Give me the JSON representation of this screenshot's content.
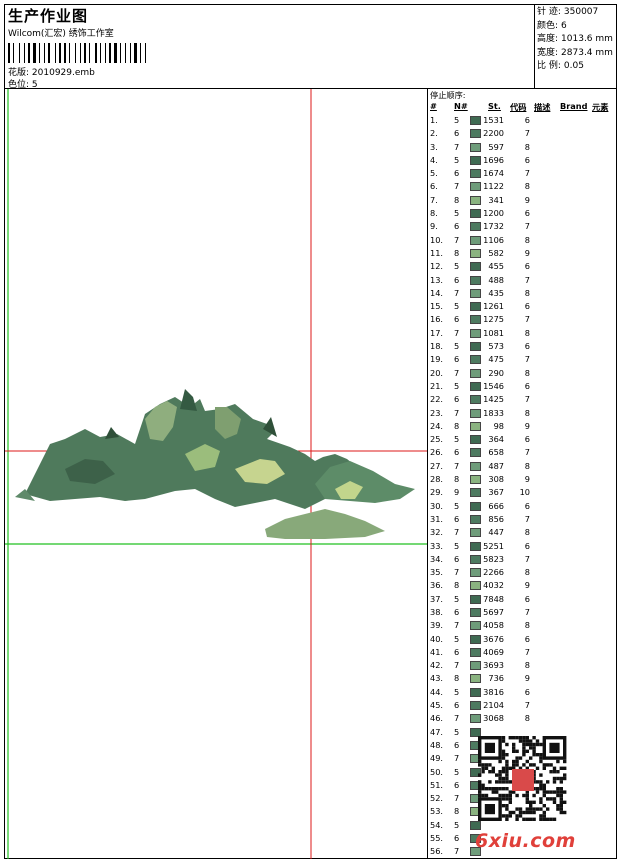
{
  "header": {
    "title": "生产作业图",
    "company": "Wilcom(汇宏) 绣饰工作室",
    "design_label": "花版:",
    "design_value": "2010929.emb",
    "color_label": "色位:",
    "color_value": "5"
  },
  "stats": [
    {
      "label": "针 迹:",
      "value": "350007"
    },
    {
      "label": "颜色:",
      "value": "6"
    },
    {
      "label": "高度:",
      "value": "1013.6 mm"
    },
    {
      "label": "宽度:",
      "value": "2873.4 mm"
    },
    {
      "label": "比 例:",
      "value": "0.05"
    }
  ],
  "legend": {
    "title": "停止顺序:",
    "headers": {
      "num": "#",
      "n": "N#",
      "st": "St.",
      "code": "代码",
      "desc": "描述",
      "brand": "Brand",
      "elem": "元素"
    },
    "colors": {
      "5": "#3f6a52",
      "6": "#4d7a60",
      "7": "#6e9c7a",
      "8": "#8ab380"
    },
    "rows": [
      {
        "num": "1.",
        "n": "5",
        "st": "1531",
        "code": "6"
      },
      {
        "num": "2.",
        "n": "6",
        "st": "2200",
        "code": "7"
      },
      {
        "num": "3.",
        "n": "7",
        "st": "597",
        "code": "8"
      },
      {
        "num": "4.",
        "n": "5",
        "st": "1696",
        "code": "6"
      },
      {
        "num": "5.",
        "n": "6",
        "st": "1674",
        "code": "7"
      },
      {
        "num": "6.",
        "n": "7",
        "st": "1122",
        "code": "8"
      },
      {
        "num": "7.",
        "n": "8",
        "st": "341",
        "code": "9"
      },
      {
        "num": "8.",
        "n": "5",
        "st": "1200",
        "code": "6"
      },
      {
        "num": "9.",
        "n": "6",
        "st": "1732",
        "code": "7"
      },
      {
        "num": "10.",
        "n": "7",
        "st": "1106",
        "code": "8"
      },
      {
        "num": "11.",
        "n": "8",
        "st": "582",
        "code": "9"
      },
      {
        "num": "12.",
        "n": "5",
        "st": "455",
        "code": "6"
      },
      {
        "num": "13.",
        "n": "6",
        "st": "488",
        "code": "7"
      },
      {
        "num": "14.",
        "n": "7",
        "st": "435",
        "code": "8"
      },
      {
        "num": "15.",
        "n": "5",
        "st": "1261",
        "code": "6"
      },
      {
        "num": "16.",
        "n": "6",
        "st": "1275",
        "code": "7"
      },
      {
        "num": "17.",
        "n": "7",
        "st": "1081",
        "code": "8"
      },
      {
        "num": "18.",
        "n": "5",
        "st": "573",
        "code": "6"
      },
      {
        "num": "19.",
        "n": "6",
        "st": "475",
        "code": "7"
      },
      {
        "num": "20.",
        "n": "7",
        "st": "290",
        "code": "8"
      },
      {
        "num": "21.",
        "n": "5",
        "st": "1546",
        "code": "6"
      },
      {
        "num": "22.",
        "n": "6",
        "st": "1425",
        "code": "7"
      },
      {
        "num": "23.",
        "n": "7",
        "st": "1833",
        "code": "8"
      },
      {
        "num": "24.",
        "n": "8",
        "st": "98",
        "code": "9"
      },
      {
        "num": "25.",
        "n": "5",
        "st": "364",
        "code": "6"
      },
      {
        "num": "26.",
        "n": "6",
        "st": "658",
        "code": "7"
      },
      {
        "num": "27.",
        "n": "7",
        "st": "487",
        "code": "8"
      },
      {
        "num": "28.",
        "n": "8",
        "st": "308",
        "code": "9"
      },
      {
        "num": "29.",
        "n": "9",
        "st": "367",
        "code": "10"
      },
      {
        "num": "30.",
        "n": "5",
        "st": "666",
        "code": "6"
      },
      {
        "num": "31.",
        "n": "6",
        "st": "856",
        "code": "7"
      },
      {
        "num": "32.",
        "n": "7",
        "st": "447",
        "code": "8"
      },
      {
        "num": "33.",
        "n": "5",
        "st": "5251",
        "code": "6"
      },
      {
        "num": "34.",
        "n": "6",
        "st": "5823",
        "code": "7"
      },
      {
        "num": "35.",
        "n": "7",
        "st": "2266",
        "code": "8"
      },
      {
        "num": "36.",
        "n": "8",
        "st": "4032",
        "code": "9"
      },
      {
        "num": "37.",
        "n": "5",
        "st": "7848",
        "code": "6"
      },
      {
        "num": "38.",
        "n": "6",
        "st": "5697",
        "code": "7"
      },
      {
        "num": "39.",
        "n": "7",
        "st": "4058",
        "code": "8"
      },
      {
        "num": "40.",
        "n": "5",
        "st": "3676",
        "code": "6"
      },
      {
        "num": "41.",
        "n": "6",
        "st": "4069",
        "code": "7"
      },
      {
        "num": "42.",
        "n": "7",
        "st": "3693",
        "code": "8"
      },
      {
        "num": "43.",
        "n": "8",
        "st": "736",
        "code": "9"
      },
      {
        "num": "44.",
        "n": "5",
        "st": "3816",
        "code": "6"
      },
      {
        "num": "45.",
        "n": "6",
        "st": "2104",
        "code": "7"
      },
      {
        "num": "46.",
        "n": "7",
        "st": "3068",
        "code": "8"
      },
      {
        "num": "47.",
        "n": "5",
        "st": "",
        "code": ""
      },
      {
        "num": "48.",
        "n": "6",
        "st": "",
        "code": ""
      },
      {
        "num": "49.",
        "n": "7",
        "st": "",
        "code": ""
      },
      {
        "num": "50.",
        "n": "5",
        "st": "",
        "code": ""
      },
      {
        "num": "51.",
        "n": "6",
        "st": "",
        "code": ""
      },
      {
        "num": "52.",
        "n": "7",
        "st": "",
        "code": ""
      },
      {
        "num": "53.",
        "n": "8",
        "st": "",
        "code": ""
      },
      {
        "num": "54.",
        "n": "5",
        "st": "",
        "code": ""
      },
      {
        "num": "55.",
        "n": "6",
        "st": "",
        "code": ""
      },
      {
        "num": "56.",
        "n": "7",
        "st": "",
        "code": ""
      }
    ]
  },
  "watermark": {
    "site": "6xiu.com"
  }
}
